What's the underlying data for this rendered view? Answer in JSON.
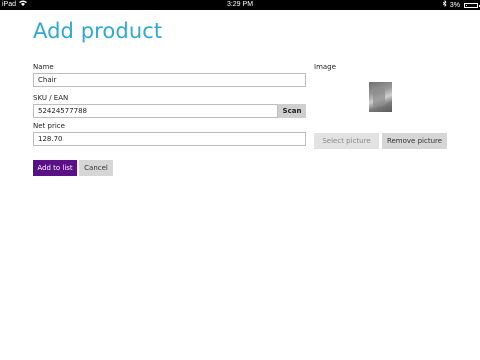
{
  "statusbar": {
    "device": "iPad",
    "wifi_icon": "wifi-icon",
    "time": "3:29 PM",
    "bluetooth_icon": "bluetooth-icon",
    "battery_percent": "3%",
    "battery_level": 0.03
  },
  "title": "Add product",
  "form": {
    "name_label": "Name",
    "name_value": "Chair",
    "sku_label": "SKU / EAN",
    "sku_value": "52424577788",
    "scan_label": "Scan",
    "price_label": "Net price",
    "price_value": "128.70",
    "image_label": "Image",
    "select_picture_label": "Select picture",
    "remove_picture_label": "Remove picture"
  },
  "actions": {
    "add_label": "Add to list",
    "cancel_label": "Cancel"
  },
  "colors": {
    "title": "#2fa8d6",
    "primary_button": "#5a1087",
    "secondary_button": "#d6d6d6"
  }
}
